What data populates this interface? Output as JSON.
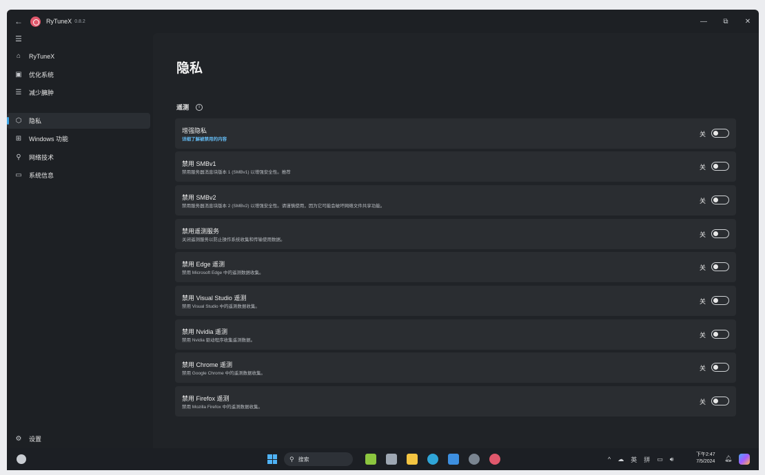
{
  "window": {
    "back_icon": "back-arrow-icon",
    "app_name": "RyTuneX",
    "version": "0.8.2",
    "controls": [
      "—",
      "⧉",
      "✕"
    ]
  },
  "sidebar": {
    "items": [
      {
        "label": "RyTuneX",
        "icon": "home-icon"
      },
      {
        "label": "优化系统",
        "icon": "optimize-icon"
      },
      {
        "label": "减少臃肿",
        "icon": "debloat-icon"
      },
      {
        "label": "隐私",
        "icon": "shield-icon",
        "active": true
      },
      {
        "label": "Windows 功能",
        "icon": "windows-features-icon"
      },
      {
        "label": "网络技术",
        "icon": "network-icon"
      },
      {
        "label": "系统信息",
        "icon": "monitor-icon"
      }
    ],
    "settings_label": "设置"
  },
  "main": {
    "title": "隐私",
    "section": "遥测",
    "settings": [
      {
        "title": "增强隐私",
        "desc": "详细了解被禁用的内容",
        "state": "关",
        "on": false,
        "link": true
      },
      {
        "title": "禁用 SMBv1",
        "desc": "禁用服务器消息块版本 1 (SMBv1) 以增强安全性。推荐",
        "state": "关",
        "on": false
      },
      {
        "title": "禁用 SMBv2",
        "desc": "禁用服务器消息块版本 2 (SMBv2) 以增强安全性。请谨慎使用，因为它可能会破坏网络文件共享功能。",
        "state": "关",
        "on": false
      },
      {
        "title": "禁用遥测服务",
        "desc": "关闭遥测服务以防止操作系统收集和传输使用数据。",
        "state": "关",
        "on": false
      },
      {
        "title": "禁用 Edge 遥测",
        "desc": "禁用 Microsoft Edge 中的遥测数据收集。",
        "state": "关",
        "on": false
      },
      {
        "title": "禁用 Visual Studio 遥测",
        "desc": "禁用 Visual Studio 中的遥测数据收集。",
        "state": "关",
        "on": false
      },
      {
        "title": "禁用 Nvidia 遥测",
        "desc": "禁用 Nvidia 驱动程序收集遥测数据。",
        "state": "关",
        "on": false
      },
      {
        "title": "禁用 Chrome 遥测",
        "desc": "禁用 Google Chrome 中的遥测数据收集。",
        "state": "关",
        "on": false
      },
      {
        "title": "禁用 Firefox 遥测",
        "desc": "禁用 Mozilla Firefox 中的遥测数据收集。",
        "state": "关",
        "on": false
      }
    ]
  },
  "taskbar": {
    "search_label": "搜索",
    "tray": {
      "expand": "^",
      "lang": "英",
      "ime": "拼"
    },
    "clock_time": "下午2:47",
    "clock_date": "7/5/2024",
    "apps": [
      {
        "name": "widgets-app",
        "color": "#8cc63f"
      },
      {
        "name": "task-view-app",
        "color": "#9ea7b3"
      },
      {
        "name": "file-explorer-app",
        "color": "#f4c542"
      },
      {
        "name": "edge-app",
        "color": "#2fa5d8"
      },
      {
        "name": "store-app",
        "color": "#3d8fe0"
      },
      {
        "name": "settings-app",
        "color": "#7a8591"
      },
      {
        "name": "rytunex-app",
        "color": "#e0586c"
      }
    ]
  },
  "colors": {
    "accent": "#3aa6e8",
    "link": "#63b9f0",
    "brand": "#e0586c"
  }
}
